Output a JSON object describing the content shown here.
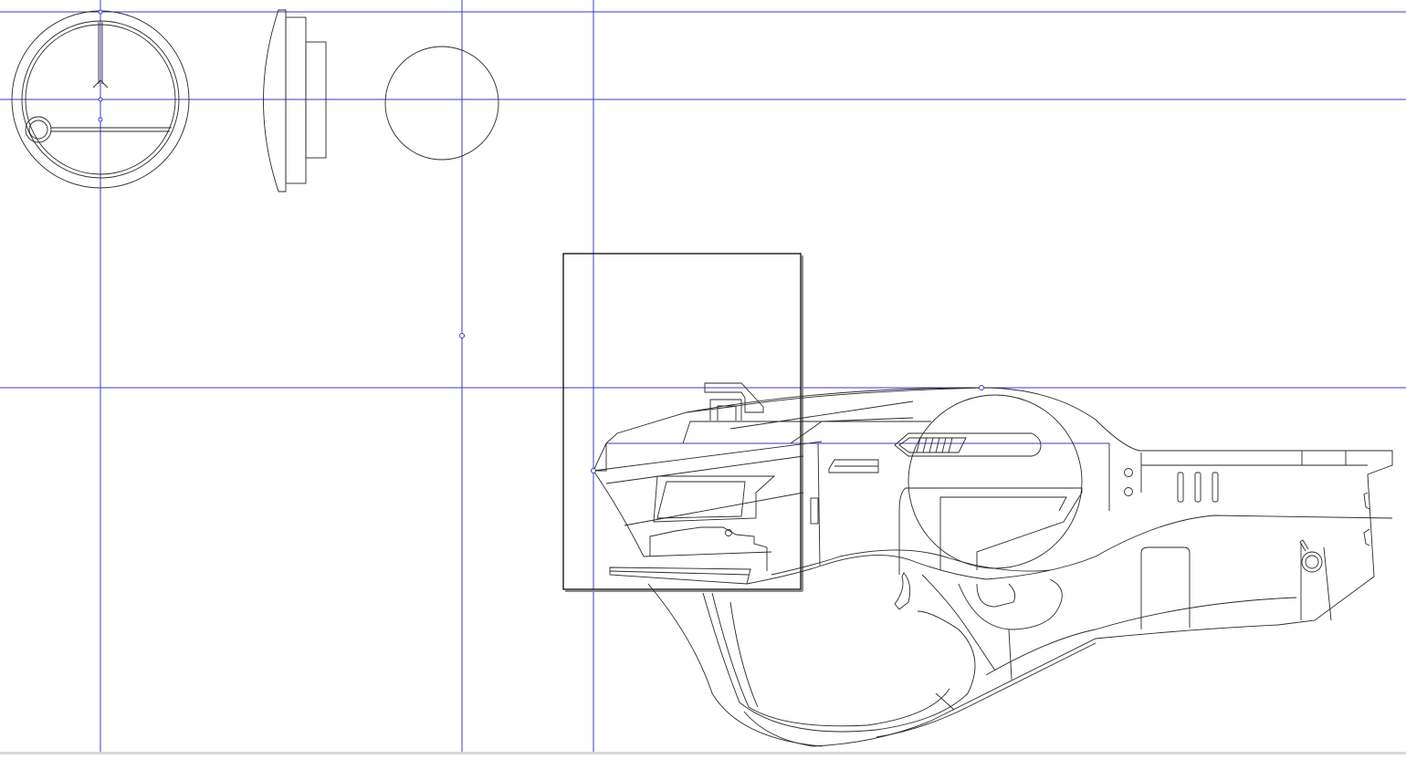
{
  "canvas": {
    "background": "#ffffff",
    "line_color": "#2a2a2a",
    "guide_color": "#3a3ac8",
    "border_color": "#d9d9d9"
  },
  "guides": {
    "horizontal_count": 3,
    "vertical_count": 3
  },
  "drawing": {
    "subject": "sci-fi-blaster-line-art",
    "parts": [
      "scope-front-view",
      "scope-side-view",
      "scope-lens-circle",
      "reference-frame",
      "blaster-body"
    ]
  }
}
